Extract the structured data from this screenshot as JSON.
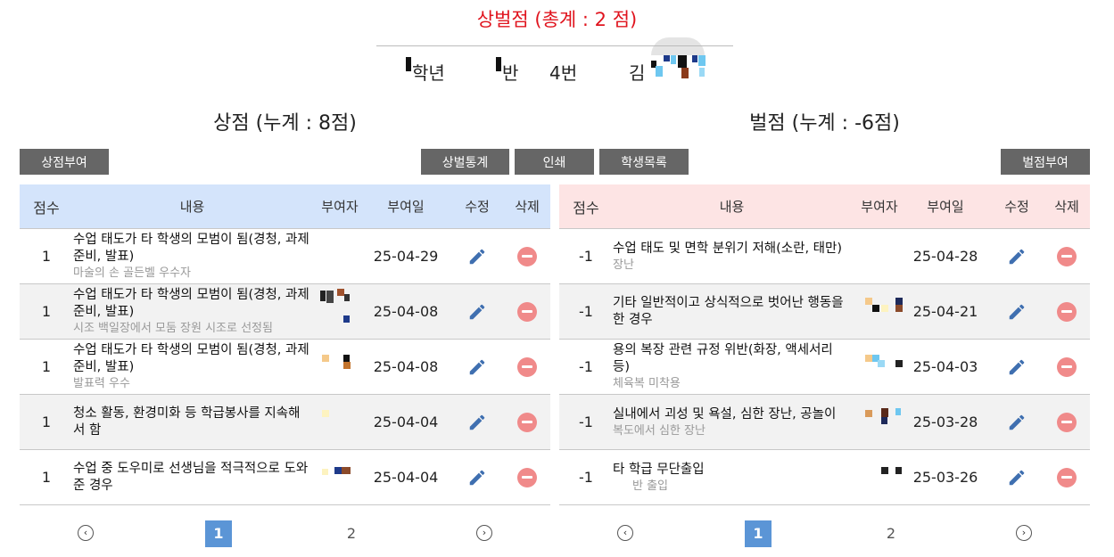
{
  "page_title": "상벌점 (총계 : 2 점)",
  "student": {
    "grade_label": "학년",
    "class_label": "반",
    "number": "4번",
    "name_prefix": "김"
  },
  "award": {
    "section_title": "상점 (누계 : 8점)",
    "give_button": "상점부여",
    "headers": {
      "score": "점수",
      "content": "내용",
      "by": "부여자",
      "date": "부여일",
      "edit": "수정",
      "delete": "삭제"
    },
    "rows": [
      {
        "score": "1",
        "text": "수업 태도가 타 학생의 모범이 됨(경청, 과제 준비, 발표)",
        "sub": "마술의 손 골든벨 우수자",
        "date": "25-04-29"
      },
      {
        "score": "1",
        "text": "수업 태도가 타 학생의 모범이 됨(경청, 과제 준비, 발표)",
        "sub": "시조 백일장에서 모둠 장원 시조로 선정됨",
        "date": "25-04-08"
      },
      {
        "score": "1",
        "text": "수업 태도가 타 학생의 모범이 됨(경청, 과제 준비, 발표)",
        "sub": "발표력 우수",
        "date": "25-04-08"
      },
      {
        "score": "1",
        "text": "청소 활동, 환경미화 등 학급봉사를 지속해서 함",
        "sub": "",
        "date": "25-04-04"
      },
      {
        "score": "1",
        "text": "수업 중 도우미로 선생님을 적극적으로 도와준 경우",
        "sub": "",
        "date": "25-04-04"
      }
    ],
    "pager": {
      "pages": [
        "1",
        "2"
      ],
      "active": "1"
    }
  },
  "toolbar": {
    "stats_button": "상벌통계",
    "print_button": "인쇄",
    "student_list_button": "학생목록"
  },
  "penalty": {
    "section_title": "벌점 (누계 : -6점)",
    "give_button": "벌점부여",
    "headers": {
      "score": "점수",
      "content": "내용",
      "by": "부여자",
      "date": "부여일",
      "edit": "수정",
      "delete": "삭제"
    },
    "rows": [
      {
        "score": "-1",
        "text": "수업 태도 및 면학 분위기 저해(소란, 태만)",
        "sub": "장난",
        "date": "25-04-28"
      },
      {
        "score": "-1",
        "text": "기타 일반적이고 상식적으로 벗어난 행동을 한 경우",
        "sub": "",
        "date": "25-04-21"
      },
      {
        "score": "-1",
        "text": "용의 복장 관련 규정 위반(화장, 액세서리 등)",
        "sub": "체육복 미착용",
        "date": "25-04-03"
      },
      {
        "score": "-1",
        "text": "실내에서 괴성 및 욕설, 심한 장난, 공놀이",
        "sub": "복도에서 심한 장난",
        "date": "25-03-28"
      },
      {
        "score": "-1",
        "text": "타 학급 무단출입",
        "sub": "반 출입",
        "date": "25-03-26"
      }
    ],
    "pager": {
      "pages": [
        "1",
        "2"
      ],
      "active": "1"
    }
  },
  "colors": {
    "title_red": "#e0141e",
    "award_header_bg": "#d4e4fb",
    "penalty_header_bg": "#fde4e4",
    "button_bg": "#666666",
    "active_page": "#5b95d6",
    "edit_icon": "#3f6fb0",
    "delete_icon": "#f08a8a"
  },
  "icons": {
    "edit": "pencil-icon",
    "delete": "minus-circle-icon",
    "prev": "chevron-left-circle-icon",
    "next": "chevron-right-circle-icon"
  }
}
